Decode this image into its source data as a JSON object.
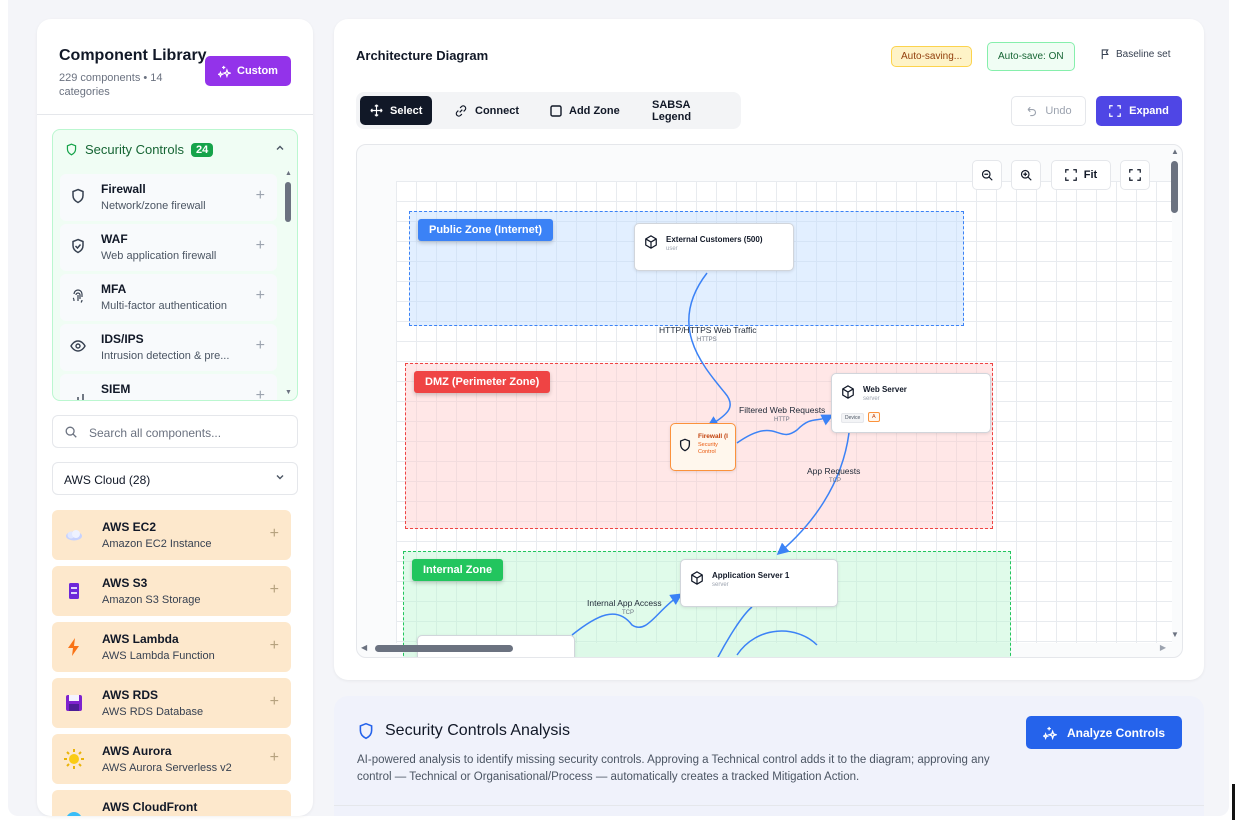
{
  "sidebar": {
    "title": "Component Library",
    "subtitle": "229 components • 14 categories",
    "custom_button": "Custom",
    "security_controls": {
      "label": "Security Controls",
      "count": "24",
      "items": [
        {
          "name": "Firewall",
          "desc": "Network/zone firewall",
          "icon": "shield-icon"
        },
        {
          "name": "WAF",
          "desc": "Web application firewall",
          "icon": "shield-check-icon"
        },
        {
          "name": "MFA",
          "desc": "Multi-factor authentication",
          "icon": "fingerprint-icon"
        },
        {
          "name": "IDS/IPS",
          "desc": "Intrusion detection & pre...",
          "icon": "eye-icon"
        },
        {
          "name": "SIEM",
          "desc": "",
          "icon": "chart-icon"
        }
      ]
    },
    "search_placeholder": "Search all components...",
    "category_select": "AWS Cloud (28)",
    "aws_items": [
      {
        "name": "AWS EC2",
        "desc": "Amazon EC2 Instance",
        "icon": "cloud-icon"
      },
      {
        "name": "AWS S3",
        "desc": "Amazon S3 Storage",
        "icon": "storage-icon"
      },
      {
        "name": "AWS Lambda",
        "desc": "AWS Lambda Function",
        "icon": "lightning-icon"
      },
      {
        "name": "AWS RDS",
        "desc": "AWS RDS Database",
        "icon": "floppy-icon"
      },
      {
        "name": "AWS Aurora",
        "desc": "AWS Aurora Serverless v2",
        "icon": "sun-icon"
      },
      {
        "name": "AWS CloudFront",
        "desc": "",
        "icon": "globe-icon"
      }
    ]
  },
  "main": {
    "title": "Architecture Diagram",
    "status_saving": "Auto-saving...",
    "status_autosave": "Auto-save: ON",
    "baseline": "Baseline set",
    "toolbar": {
      "select": "Select",
      "connect": "Connect",
      "add_zone": "Add Zone",
      "legend": "SABSA Legend"
    },
    "undo": "Undo",
    "expand": "Expand",
    "fit": "Fit"
  },
  "diagram": {
    "zones": {
      "public": "Public Zone (Internet)",
      "dmz": "DMZ (Perimeter Zone)",
      "internal": "Internal Zone"
    },
    "nodes": {
      "customers": {
        "title": "External Customers (500)",
        "sub": "user"
      },
      "firewall": {
        "title": "Firewall (I",
        "sub": "Security Control"
      },
      "webserver": {
        "title": "Web Server",
        "sub": "server",
        "tag1": "Device",
        "tag2": "A"
      },
      "appserver": {
        "title": "Application Server 1",
        "sub": "server"
      }
    },
    "edges": {
      "e1": {
        "label": "HTTP/HTTPS Web Traffic",
        "proto": "HTTPS"
      },
      "e2": {
        "label": "Filtered Web Requests",
        "proto": "HTTP"
      },
      "e3": {
        "label": "App Requests",
        "proto": "TCP"
      },
      "e4": {
        "label": "Internal App Access",
        "proto": "TCP"
      }
    }
  },
  "analysis": {
    "title": "Security Controls Analysis",
    "description": "AI-powered analysis to identify missing security controls. Approving a Technical control adds it to the diagram; approving any control — Technical or Organisational/Process — automatically creates a tracked Mitigation Action.",
    "button": "Analyze Controls"
  },
  "colors": {
    "accent_purple": "#9333ea",
    "accent_indigo": "#4f46e5",
    "accent_blue": "#2563eb",
    "zone_public": "#3b82f6",
    "zone_dmz": "#ef4444",
    "zone_internal": "#22c55e"
  }
}
